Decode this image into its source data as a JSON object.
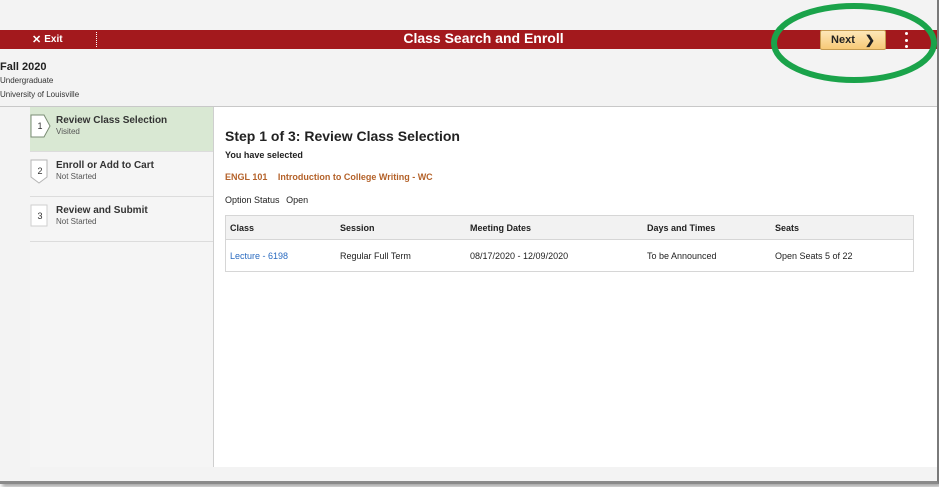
{
  "header": {
    "exit_label": "Exit",
    "title": "Class Search and Enroll",
    "next_label": "Next",
    "term": "Fall 2020",
    "career": "Undergraduate",
    "institution": "University of Louisville"
  },
  "steps": [
    {
      "number": "1",
      "title": "Review Class Selection",
      "status": "Visited"
    },
    {
      "number": "2",
      "title": "Enroll or Add to Cart",
      "status": "Not Started"
    },
    {
      "number": "3",
      "title": "Review and Submit",
      "status": "Not Started"
    }
  ],
  "main": {
    "heading": "Step 1 of 3: Review Class Selection",
    "selected_label": "You have selected",
    "course_code": "ENGL 101",
    "course_title": "Introduction to College Writing - WC",
    "option_status_label": "Option Status",
    "option_status_value": "Open",
    "table": {
      "headers": [
        "Class",
        "Session",
        "Meeting Dates",
        "Days and Times",
        "Seats"
      ],
      "rows": [
        [
          "Lecture - 6198",
          "Regular Full Term",
          "08/17/2020 - 12/09/2020",
          "To be Announced",
          "Open Seats 5 of 22"
        ]
      ]
    }
  },
  "colors": {
    "header_bar": "#a3191d",
    "active_step": "#d9e8d3",
    "course_text": "#b4622a",
    "link": "#2a6bc0",
    "annotation_circle": "#1aa34a"
  }
}
